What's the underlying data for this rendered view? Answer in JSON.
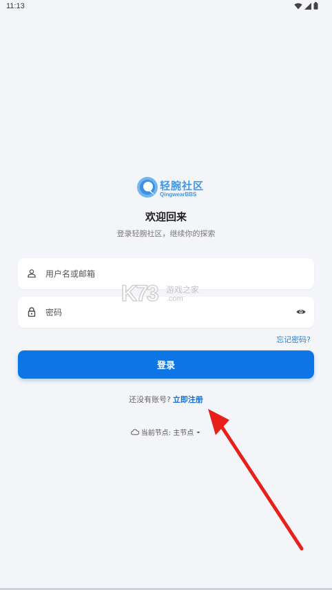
{
  "status_bar": {
    "time": "11:13"
  },
  "logo": {
    "name": "轻腕社区",
    "subtitle": "QingwearBBS",
    "color": "#3f97e8"
  },
  "welcome": {
    "title": "欢迎回来",
    "subtitle": "登录轻腕社区，继续你的探索"
  },
  "form": {
    "username_placeholder": "用户名或邮箱",
    "password_placeholder": "密码",
    "forgot_password": "忘记密码?",
    "login_label": "登录"
  },
  "register": {
    "prompt": "还没有账号?",
    "link": "立即注册"
  },
  "node": {
    "label": "当前节点: 主节点"
  },
  "watermark": {
    "main": "K73",
    "cn": "游戏之家",
    "com": ".com"
  },
  "colors": {
    "accent": "#0d76e6",
    "link": "#1470d6",
    "annotation": "#e8201c"
  }
}
